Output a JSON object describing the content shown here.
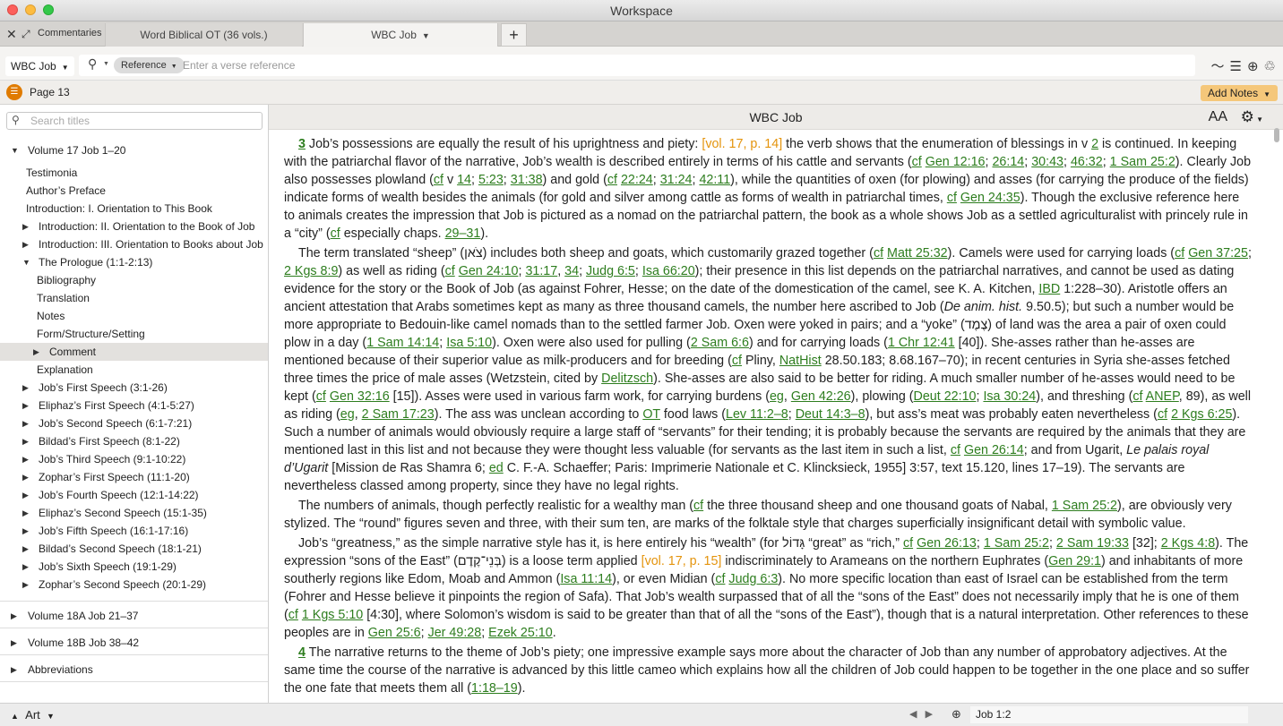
{
  "window": {
    "title": "Workspace"
  },
  "tabbar": {
    "panel_label": "Commentaries",
    "tabs": [
      {
        "label": "Word Biblical OT (36 vols.)"
      },
      {
        "label": "WBC Job"
      }
    ],
    "add_label": "+"
  },
  "toolbar": {
    "resource": "WBC Job",
    "search_mode": "Reference",
    "search_placeholder": "Enter a verse reference"
  },
  "pagebar": {
    "page_label": "Page 13",
    "add_notes": "Add Notes"
  },
  "sidebar": {
    "search_placeholder": "Search titles",
    "items": [
      {
        "label": "Volume 17 Job 1–20"
      },
      {
        "label": "Testimonia"
      },
      {
        "label": "Author’s Preface"
      },
      {
        "label": "Introduction: I. Orientation to This Book"
      },
      {
        "label": "Introduction: II. Orientation to the Book of Job"
      },
      {
        "label": "Introduction: III. Orientation to Books about Job"
      },
      {
        "label": "The Prologue (1:1-2:13)"
      },
      {
        "label": "Bibliography"
      },
      {
        "label": "Translation"
      },
      {
        "label": "Notes"
      },
      {
        "label": "Form/Structure/Setting"
      },
      {
        "label": "Comment"
      },
      {
        "label": "Explanation"
      },
      {
        "label": "Job’s First Speech (3:1-26)"
      },
      {
        "label": "Eliphaz’s First Speech (4:1-5:27)"
      },
      {
        "label": "Job’s Second Speech (6:1-7:21)"
      },
      {
        "label": "Bildad’s First Speech (8:1-22)"
      },
      {
        "label": "Job’s Third Speech (9:1-10:22)"
      },
      {
        "label": "Zophar’s First Speech (11:1-20)"
      },
      {
        "label": "Job’s Fourth Speech (12:1-14:22)"
      },
      {
        "label": "Eliphaz’s Second Speech (15:1-35)"
      },
      {
        "label": "Job’s Fifth Speech (16:1-17:16)"
      },
      {
        "label": "Bildad’s Second Speech (18:1-21)"
      },
      {
        "label": "Job’s Sixth Speech (19:1-29)"
      },
      {
        "label": "Zophar’s Second Speech (20:1-29)"
      },
      {
        "label": "Volume 18A Job 21–37"
      },
      {
        "label": "Volume 18B Job 38–42"
      },
      {
        "label": "Abbreviations"
      }
    ]
  },
  "content": {
    "title": "WBC Job",
    "font_size_icon": "AA"
  },
  "footer": {
    "panel_label": "Art",
    "reference": "Job 1:2"
  }
}
